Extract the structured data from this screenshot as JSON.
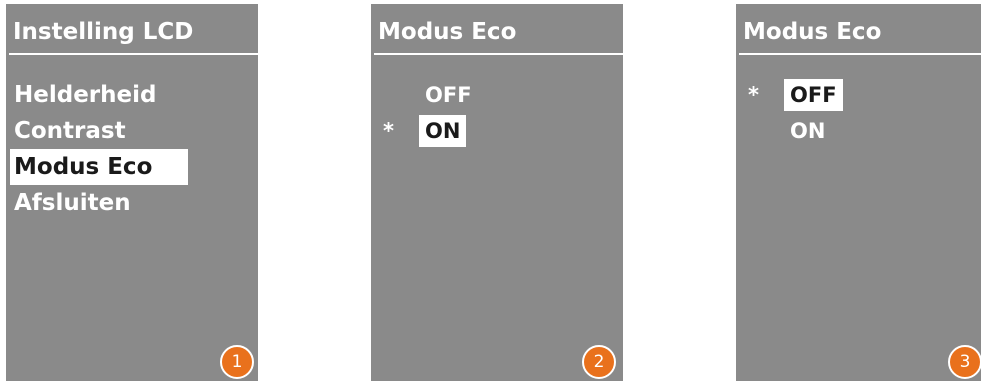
{
  "colors": {
    "screen_background": "#8a8a8a",
    "text": "#ffffff",
    "highlight_background": "#ffffff",
    "highlight_text": "#1a1a1a",
    "badge": "#e9711c"
  },
  "screens": [
    {
      "title": "Instelling LCD",
      "items": [
        "Helderheid",
        "Contrast",
        "Modus Eco",
        "Afsluiten"
      ],
      "selected_item": "Modus Eco",
      "step": "1"
    },
    {
      "title": "Modus Eco",
      "options": [
        "OFF",
        "ON"
      ],
      "marker": "*",
      "selected_option": "ON",
      "step": "2"
    },
    {
      "title": "Modus Eco",
      "options": [
        "OFF",
        "ON"
      ],
      "marker": "*",
      "selected_option": "OFF",
      "step": "3"
    }
  ]
}
